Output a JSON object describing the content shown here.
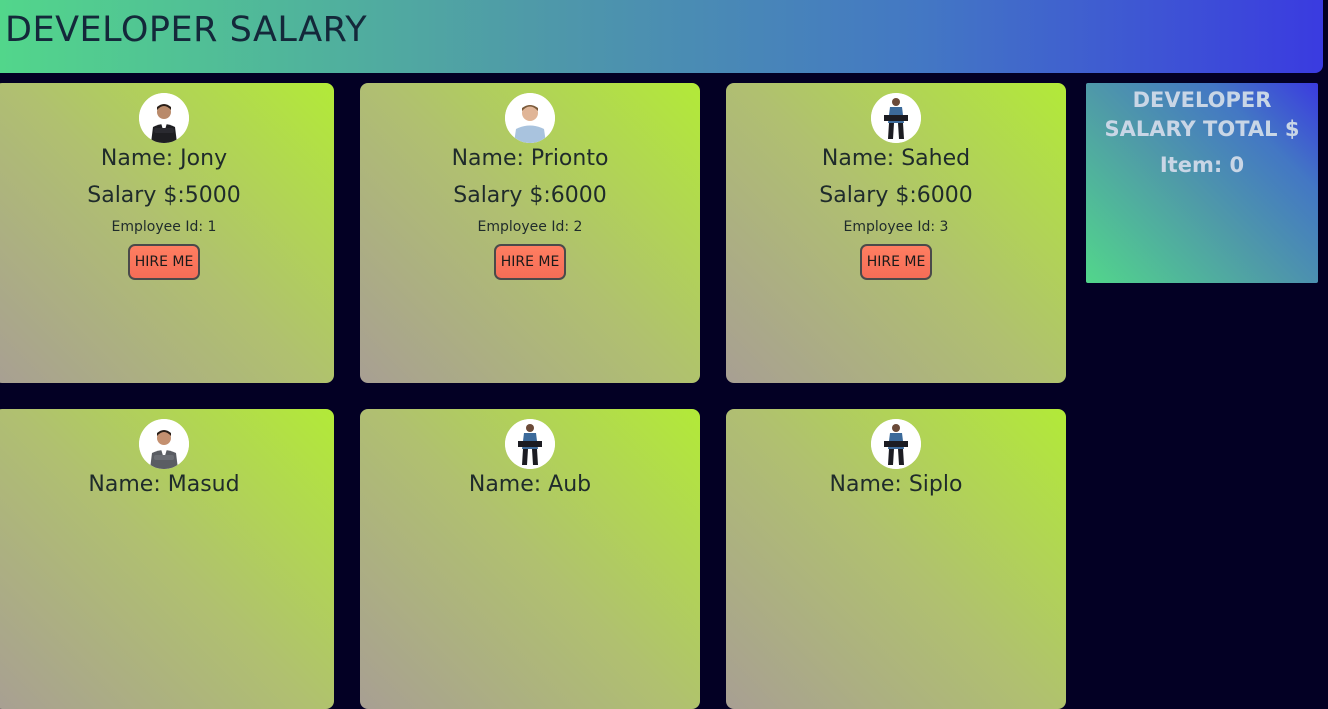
{
  "header": {
    "title": "DEVELOPER SALARY"
  },
  "employees": [
    {
      "name_text": "Name: Jony",
      "salary_text": "Salary $:5000",
      "id_text": "Employee Id: 1",
      "hire_label": "HIRE ME",
      "avatar_icon": "man-in-suit-arms-crossed-avatar"
    },
    {
      "name_text": "Name: Prionto",
      "salary_text": "Salary $:6000",
      "id_text": "Employee Id: 2",
      "hire_label": "HIRE ME",
      "avatar_icon": "man-light-shirt-avatar"
    },
    {
      "name_text": "Name: Sahed",
      "salary_text": "Salary $:6000",
      "id_text": "Employee Id: 3",
      "hire_label": "HIRE ME",
      "avatar_icon": "man-sitting-avatar"
    },
    {
      "name_text": "Name: Masud",
      "salary_text": "",
      "id_text": "",
      "hire_label": "",
      "avatar_icon": "man-grey-suit-avatar"
    },
    {
      "name_text": "Name: Aub",
      "salary_text": "",
      "id_text": "",
      "hire_label": "",
      "avatar_icon": "man-sitting-avatar"
    },
    {
      "name_text": "Name: Siplo",
      "salary_text": "",
      "id_text": "",
      "hire_label": "",
      "avatar_icon": "man-sitting-avatar"
    }
  ],
  "summary": {
    "title": "DEVELOPER SALARY TOTAL $",
    "item_text": "Item: 0"
  },
  "colors": {
    "page_background": "#030024",
    "header_gradient_start": "#52d68b",
    "header_gradient_end": "#3a3be0",
    "card_gradient_start": "#a89f93",
    "card_gradient_end": "#b2ea38",
    "hire_button": "#ff7e61"
  }
}
